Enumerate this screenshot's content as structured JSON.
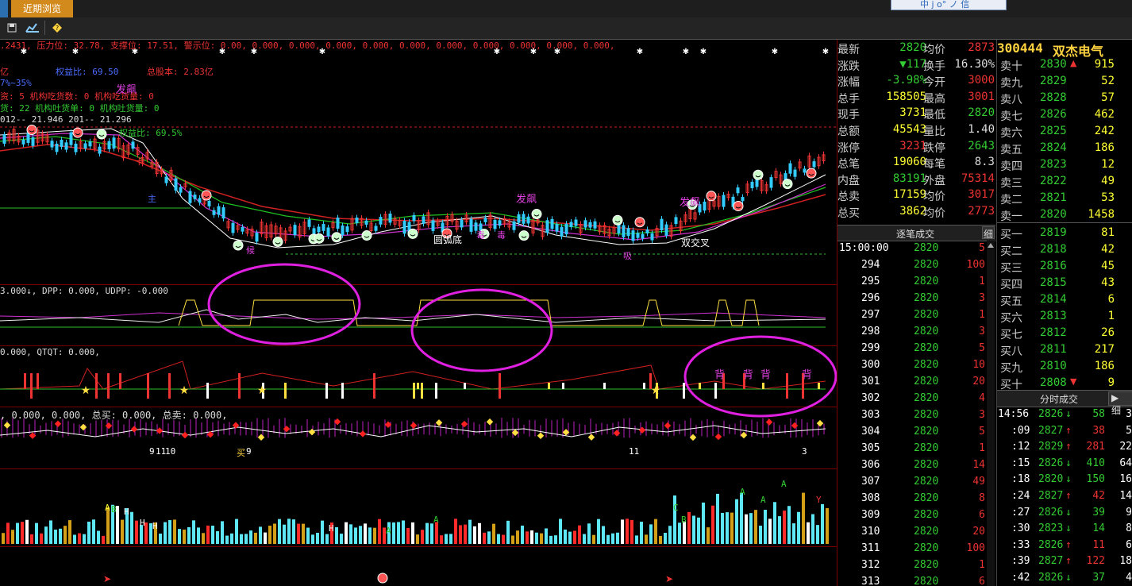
{
  "window": {
    "tab_recent": "近期浏览",
    "top_widget_text": "中 j  o°  ノ 信"
  },
  "toolbar": {
    "icons": [
      "save-icon",
      "chart-icon",
      "diamond-nav-icon"
    ]
  },
  "chart": {
    "info_line": ".2431, 压力位: 32.78, 支撑位: 17.51, 警示位: 0.00, 0.000, 0.000, 0.000, 0.000, 0.000, 0.000, 0.000, 0.000, 0.000, 0.000,",
    "info_rows": [
      {
        "text": "权益比: 69.50",
        "color": "#4a6cff"
      },
      {
        "text": "总股本: 2.83亿",
        "color": "#e33"
      },
      {
        "text": "资: 5      机构吃货数: 0      机构吃货量: 0",
        "color": "#e33"
      },
      {
        "text": "货: 22     机构吐货单: 0      机构吐货量: 0",
        "color": "#3c3"
      },
      {
        "text": "012-- 21.946     201-- 21.296",
        "color": "#ddd"
      },
      {
        "text": "权益比: 69.5%",
        "color": "#3c3"
      }
    ],
    "left_partial_labels": [
      "亿",
      "7%~35%"
    ],
    "annotations": {
      "fa_biao_1": "发飙",
      "fa_biao_2": "发飙",
      "fa_biao_3": "发飙",
      "round_bottom": "圆弧底",
      "double_cross": "双交叉",
      "du_1": "毒",
      "du_2": "毒",
      "ka": "卡",
      "zhu": "主",
      "xi": "吸",
      "hou": "候"
    },
    "indicator1_label": "3.000↓, DPP: 0.000, UDPP: -0.000",
    "indicator2_label": "0.000, QTQT: 0.000,",
    "indicator3_label": ", 0.000, 0.000, 总买: 0.000, 总卖: 0.000,",
    "low_labels": [
      "9",
      "11",
      "10",
      "买",
      "9",
      "11",
      "3"
    ],
    "vol_labels": [
      "A",
      "B",
      "H",
      "H",
      "H",
      "H",
      "A",
      "A",
      "C",
      "B",
      "A",
      "A",
      "A",
      "Y"
    ],
    "bei": [
      "背",
      "背",
      "背",
      "背"
    ]
  },
  "quote": {
    "rows": [
      {
        "k1": "最新",
        "v1": "2820",
        "c1": "#3c3",
        "k2": "均价",
        "v2": "2873",
        "c2": "#e33"
      },
      {
        "k1": "涨跌",
        "v1": "▼117",
        "c1": "#3c3",
        "k2": "换手",
        "v2": "16.30%",
        "c2": "#ddd"
      },
      {
        "k1": "涨幅",
        "v1": "-3.98%",
        "c1": "#3c3",
        "k2": "今开",
        "v2": "3000",
        "c2": "#e33"
      },
      {
        "k1": "总手",
        "v1": "158505",
        "c1": "#ff3",
        "k2": "最高",
        "v2": "3001",
        "c2": "#e33"
      },
      {
        "k1": "现手",
        "v1": "3731",
        "c1": "#ff3",
        "k2": "最低",
        "v2": "2820",
        "c2": "#3c3"
      },
      {
        "k1": "总额",
        "v1": "45543",
        "c1": "#ff3",
        "k2": "量比",
        "v2": "1.40",
        "c2": "#ddd"
      },
      {
        "k1": "涨停",
        "v1": "3231",
        "c1": "#e33",
        "k2": "跌停",
        "v2": "2643",
        "c2": "#3c3"
      },
      {
        "k1": "总笔",
        "v1": "19060",
        "c1": "#ff3",
        "k2": "每笔",
        "v2": "8.3",
        "c2": "#ddd"
      },
      {
        "k1": "内盘",
        "v1": "83191",
        "c1": "#3c3",
        "k2": "外盘",
        "v2": "75314",
        "c2": "#e33"
      },
      {
        "k1": "总卖",
        "v1": "17159",
        "c1": "#ff3",
        "k2": "均价",
        "v2": "3017",
        "c2": "#e33"
      },
      {
        "k1": "总买",
        "v1": "3862",
        "c1": "#ff3",
        "k2": "均价",
        "v2": "2773",
        "c2": "#e33"
      }
    ]
  },
  "ticks": {
    "header": "逐笔成交",
    "header_btn": "细",
    "rows": [
      {
        "t": "15:00:00",
        "p": "2820",
        "v": "5"
      },
      {
        "t": "294",
        "p": "2820",
        "v": "100"
      },
      {
        "t": "295",
        "p": "2820",
        "v": "1"
      },
      {
        "t": "296",
        "p": "2820",
        "v": "3"
      },
      {
        "t": "297",
        "p": "2820",
        "v": "1"
      },
      {
        "t": "298",
        "p": "2820",
        "v": "3"
      },
      {
        "t": "299",
        "p": "2820",
        "v": "5"
      },
      {
        "t": "300",
        "p": "2820",
        "v": "10"
      },
      {
        "t": "301",
        "p": "2820",
        "v": "20"
      },
      {
        "t": "302",
        "p": "2820",
        "v": "4"
      },
      {
        "t": "303",
        "p": "2820",
        "v": "3"
      },
      {
        "t": "304",
        "p": "2820",
        "v": "5"
      },
      {
        "t": "305",
        "p": "2820",
        "v": "1"
      },
      {
        "t": "306",
        "p": "2820",
        "v": "14"
      },
      {
        "t": "307",
        "p": "2820",
        "v": "49"
      },
      {
        "t": "308",
        "p": "2820",
        "v": "8"
      },
      {
        "t": "309",
        "p": "2820",
        "v": "6"
      },
      {
        "t": "310",
        "p": "2820",
        "v": "20"
      },
      {
        "t": "311",
        "p": "2820",
        "v": "100"
      },
      {
        "t": "312",
        "p": "2820",
        "v": "1"
      },
      {
        "t": "313",
        "p": "2820",
        "v": "6"
      }
    ]
  },
  "stock": {
    "code": "300444",
    "name": "双杰电气"
  },
  "orderbook": {
    "asks": [
      {
        "label": "卖十",
        "price": "2830",
        "arrow": "▲",
        "vol": "915"
      },
      {
        "label": "卖九",
        "price": "2829",
        "arrow": "",
        "vol": "52"
      },
      {
        "label": "卖八",
        "price": "2828",
        "arrow": "",
        "vol": "57"
      },
      {
        "label": "卖七",
        "price": "2826",
        "arrow": "",
        "vol": "462"
      },
      {
        "label": "卖六",
        "price": "2825",
        "arrow": "",
        "vol": "242"
      },
      {
        "label": "卖五",
        "price": "2824",
        "arrow": "",
        "vol": "186"
      },
      {
        "label": "卖四",
        "price": "2823",
        "arrow": "",
        "vol": "12"
      },
      {
        "label": "卖三",
        "price": "2822",
        "arrow": "",
        "vol": "49"
      },
      {
        "label": "卖二",
        "price": "2821",
        "arrow": "",
        "vol": "53"
      },
      {
        "label": "卖一",
        "price": "2820",
        "arrow": "",
        "vol": "1458"
      }
    ],
    "bids": [
      {
        "label": "买一",
        "price": "2819",
        "arrow": "",
        "vol": "81"
      },
      {
        "label": "买二",
        "price": "2818",
        "arrow": "",
        "vol": "42"
      },
      {
        "label": "买三",
        "price": "2816",
        "arrow": "",
        "vol": "45"
      },
      {
        "label": "买四",
        "price": "2815",
        "arrow": "",
        "vol": "43"
      },
      {
        "label": "买五",
        "price": "2814",
        "arrow": "",
        "vol": "6"
      },
      {
        "label": "买六",
        "price": "2813",
        "arrow": "",
        "vol": "1"
      },
      {
        "label": "买七",
        "price": "2812",
        "arrow": "",
        "vol": "26"
      },
      {
        "label": "买八",
        "price": "2811",
        "arrow": "",
        "vol": "217"
      },
      {
        "label": "买九",
        "price": "2810",
        "arrow": "",
        "vol": "186"
      },
      {
        "label": "买十",
        "price": "2808",
        "arrow": "▼",
        "vol": "9"
      }
    ]
  },
  "minute": {
    "header": "分时成交",
    "header_btn": "▶ 细",
    "rows": [
      {
        "t": "14:56",
        "p": "2826",
        "d": "down",
        "v": "58",
        "n": "3"
      },
      {
        "t": ":09",
        "p": "2827",
        "d": "up",
        "v": "38",
        "n": "5"
      },
      {
        "t": ":12",
        "p": "2829",
        "d": "up",
        "v": "281",
        "n": "22"
      },
      {
        "t": ":15",
        "p": "2826",
        "d": "down",
        "v": "410",
        "n": "64"
      },
      {
        "t": ":18",
        "p": "2820",
        "d": "down",
        "v": "150",
        "n": "16"
      },
      {
        "t": ":24",
        "p": "2827",
        "d": "up",
        "v": "42",
        "n": "14"
      },
      {
        "t": ":27",
        "p": "2826",
        "d": "down",
        "v": "39",
        "n": "9"
      },
      {
        "t": ":30",
        "p": "2823",
        "d": "down",
        "v": "14",
        "n": "8"
      },
      {
        "t": ":33",
        "p": "2826",
        "d": "up",
        "v": "11",
        "n": "6"
      },
      {
        "t": ":39",
        "p": "2827",
        "d": "up",
        "v": "122",
        "n": "18"
      },
      {
        "t": ":42",
        "p": "2826",
        "d": "down",
        "v": "37",
        "n": "4"
      }
    ]
  },
  "colors": {
    "up": "#e33",
    "down": "#3c3",
    "accent": "#d38a1c",
    "volume": "#ff3",
    "magenta": "#e040e0"
  }
}
